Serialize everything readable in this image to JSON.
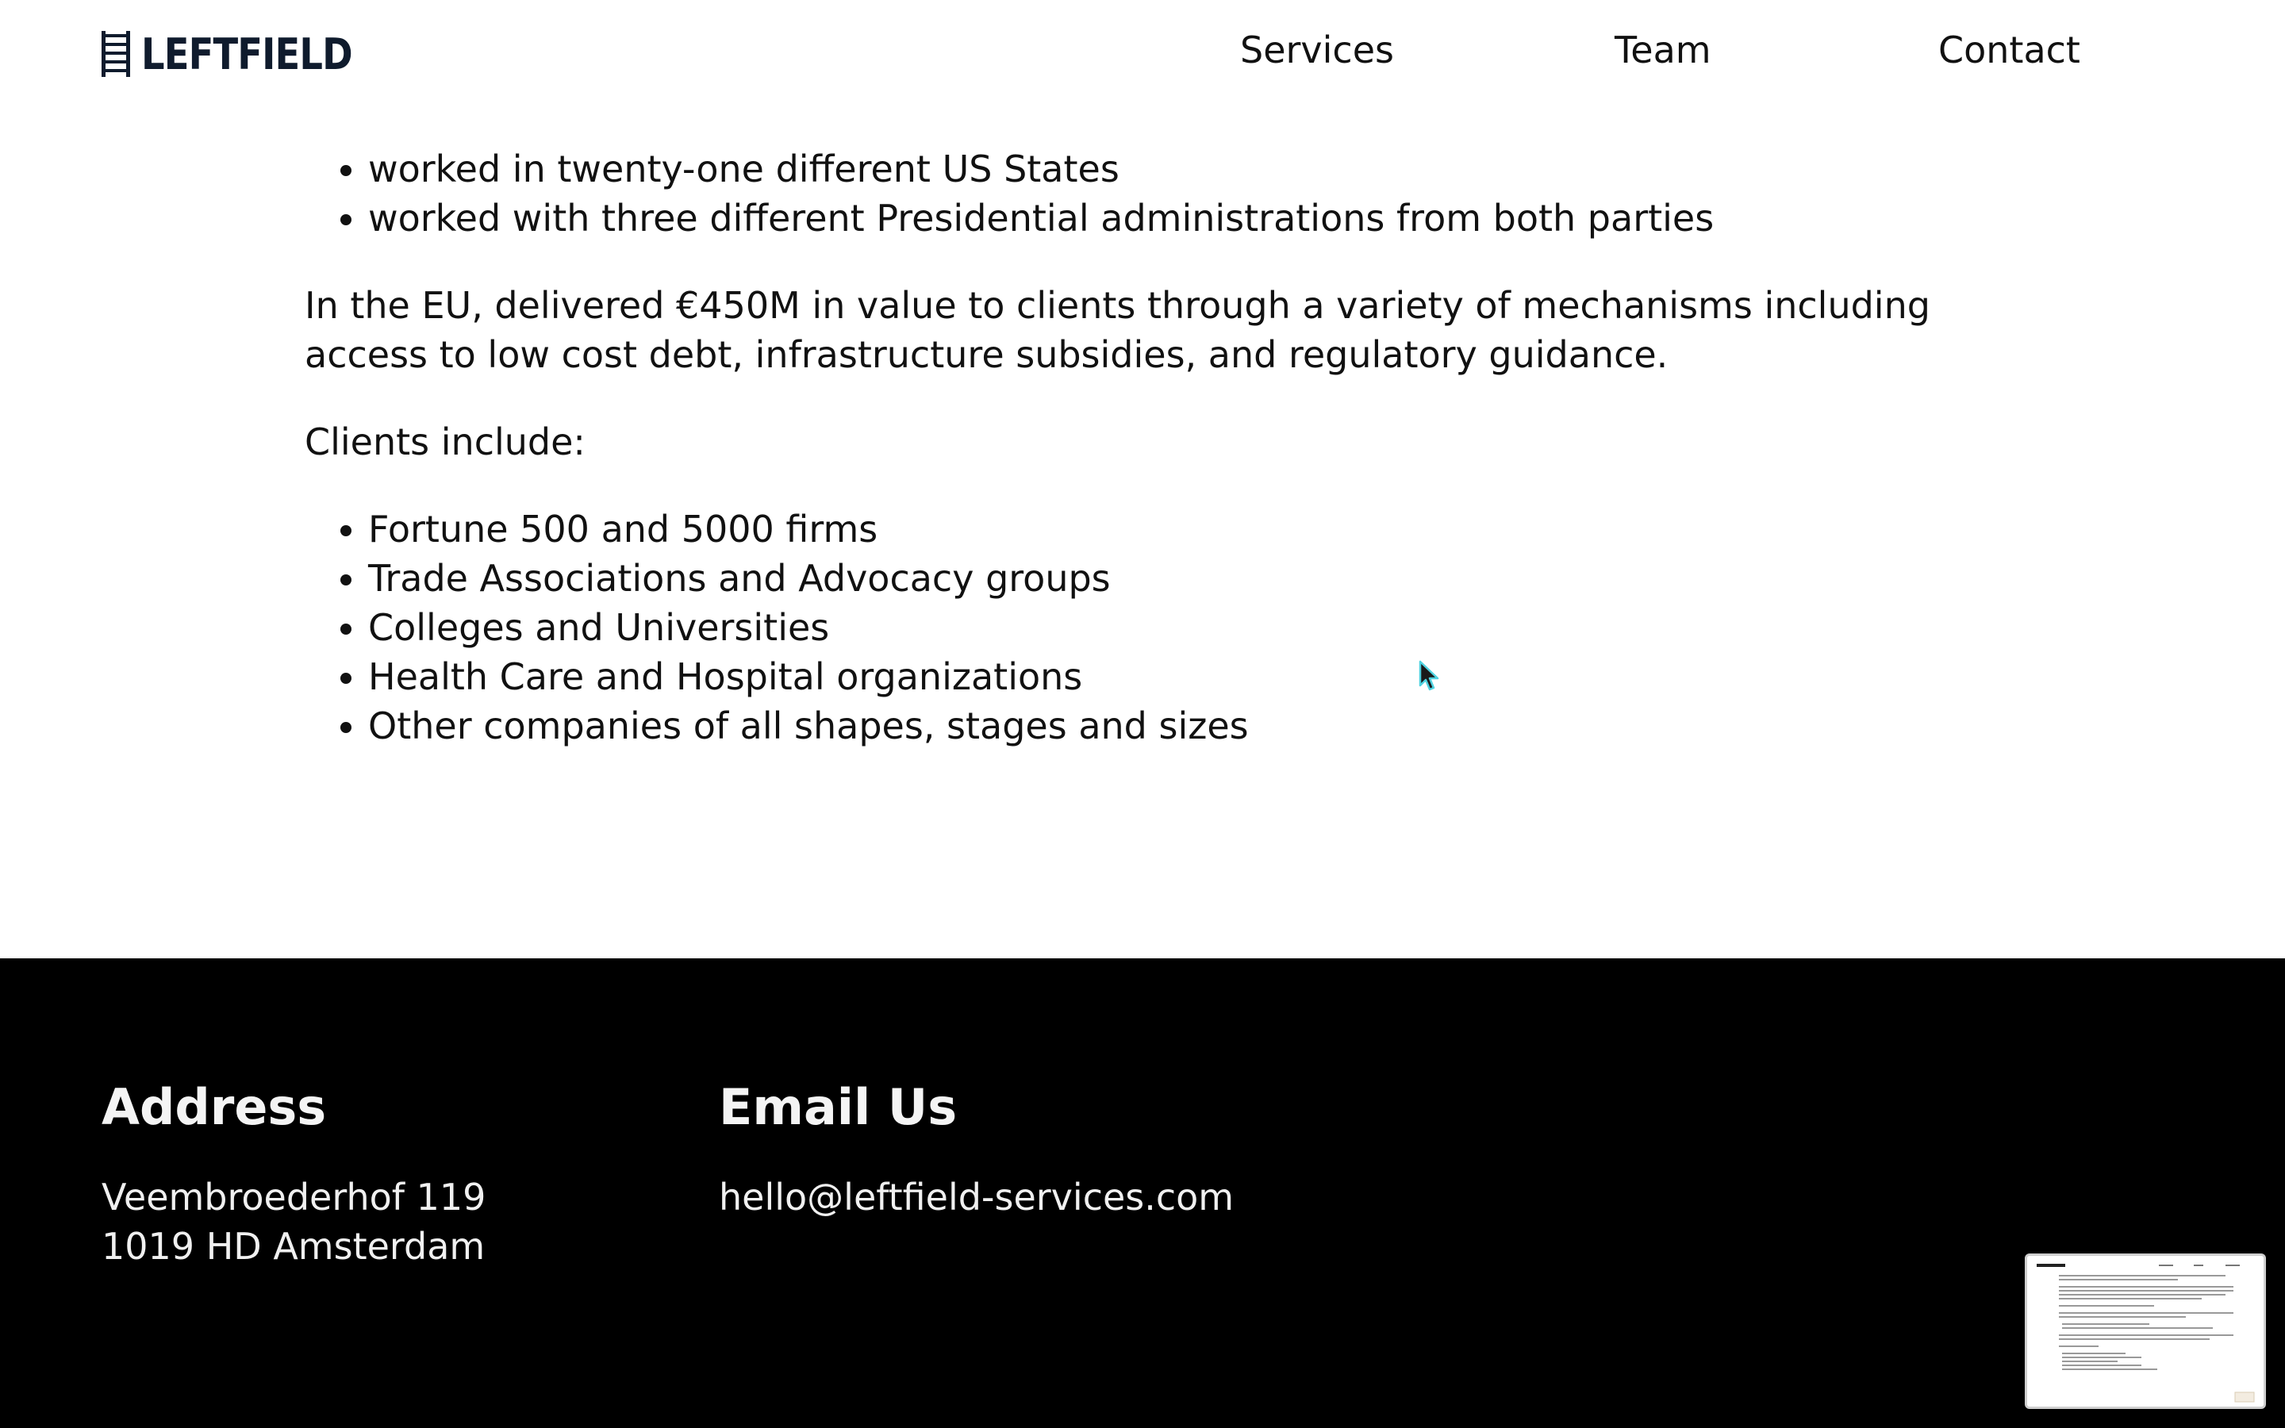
{
  "header": {
    "logo_text": "LEFTFIELD",
    "nav": {
      "services": "Services",
      "team": "Team",
      "contact": "Contact"
    }
  },
  "content": {
    "states_list": [
      "worked in twenty-one different US States",
      "worked with three different Presidential administrations from both parties"
    ],
    "eu_paragraph": "In the EU, delivered €450M in value to clients through a variety of mechanisms including access to low cost debt, infrastructure subsidies, and regulatory guidance.",
    "clients_intro": "Clients include:",
    "clients_list": [
      "Fortune 500 and 5000 firms",
      "Trade Associations and Advocacy groups",
      "Colleges and Universities",
      "Health Care and Hospital organizations",
      "Other companies of all shapes, stages and sizes"
    ]
  },
  "footer": {
    "address_heading": "Address",
    "address_line1": "Veembroederhof 119",
    "address_line2": "1019 HD Amsterdam",
    "email_heading": "Email Us",
    "email": "hello@leftfield-services.com"
  },
  "colors": {
    "logo": "#0f1b2d",
    "footer_bg": "#000000",
    "text": "#111111"
  },
  "icons": {
    "logo": "ladder-icon",
    "cursor": "mouse-pointer-icon"
  }
}
